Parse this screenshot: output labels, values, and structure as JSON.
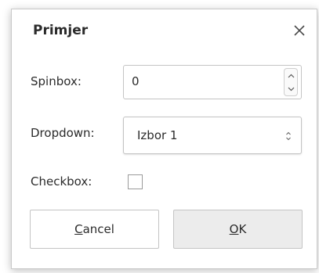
{
  "dialog": {
    "title": "Primjer",
    "close_icon": "close-icon"
  },
  "spinbox": {
    "label": "Spinbox:",
    "value": "0",
    "up_icon": "chevron-up-icon",
    "down_icon": "chevron-down-icon"
  },
  "dropdown": {
    "label": "Dropdown:",
    "selected": "Izbor 1",
    "icon": "updown-arrows-icon"
  },
  "checkbox": {
    "label": "Checkbox:",
    "checked": false
  },
  "buttons": {
    "cancel": {
      "mnemonic": "C",
      "rest": "ancel"
    },
    "ok": {
      "mnemonic": "O",
      "rest": "K"
    }
  },
  "colors": {
    "border": "#c4c4c4",
    "ok_bg": "#ececec",
    "text": "#2b2b2b"
  }
}
